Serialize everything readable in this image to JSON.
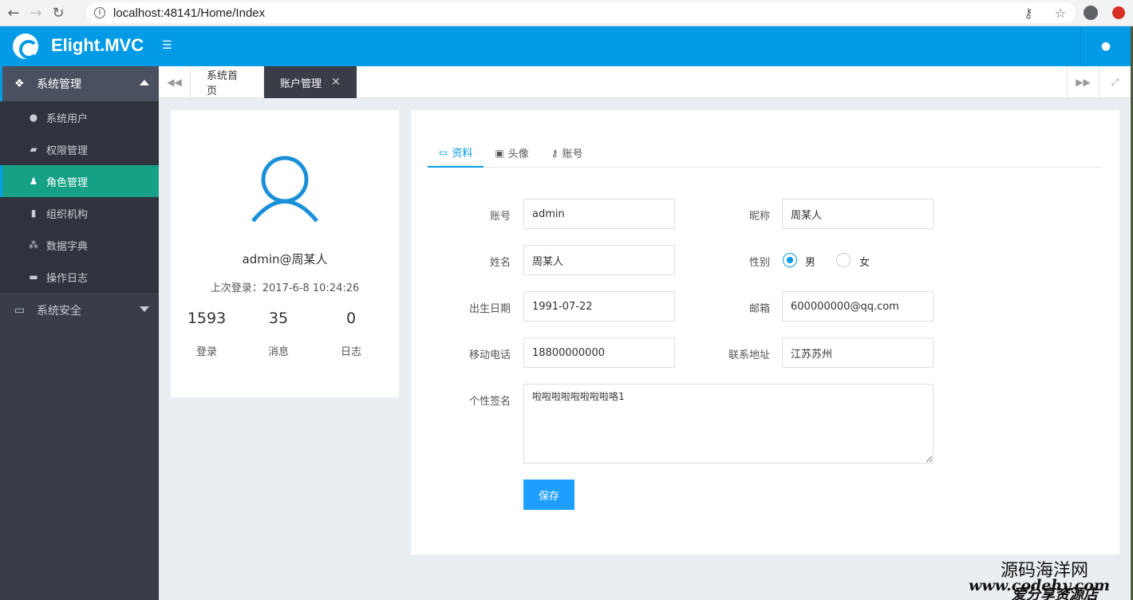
{
  "browser": {
    "url": "localhost:48141/Home/Index"
  },
  "header": {
    "app_title": "Elight.MVC"
  },
  "sidebar": {
    "groups": [
      {
        "label": "系统管理",
        "expanded": true,
        "items": [
          {
            "label": "系统用户",
            "icon": "user-circle-icon"
          },
          {
            "label": "权限管理",
            "icon": "briefcase-icon"
          },
          {
            "label": "角色管理",
            "icon": "users-icon",
            "active": true
          },
          {
            "label": "组织机构",
            "icon": "building-icon"
          },
          {
            "label": "数据字典",
            "icon": "sitemap-icon"
          },
          {
            "label": "操作日志",
            "icon": "folder-open-icon"
          }
        ]
      },
      {
        "label": "系统安全",
        "expanded": false
      }
    ]
  },
  "tabs": {
    "items": [
      {
        "label": "系统首页"
      },
      {
        "label": "账户管理",
        "active": true
      }
    ]
  },
  "profile": {
    "name": "admin@周某人",
    "last_login_label": "上次登录：",
    "last_login_value": "2017-6-8 10:24:26",
    "stats": [
      {
        "value": "1593",
        "label": "登录"
      },
      {
        "value": "35",
        "label": "消息"
      },
      {
        "value": "0",
        "label": "日志"
      }
    ]
  },
  "form": {
    "tabs": [
      {
        "label": "资料",
        "icon": "id-card-icon",
        "active": true
      },
      {
        "label": "头像",
        "icon": "image-icon"
      },
      {
        "label": "账号",
        "icon": "key-icon"
      }
    ],
    "fields": {
      "account": {
        "label": "账号",
        "value": "admin"
      },
      "nickname": {
        "label": "昵称",
        "value": "周某人"
      },
      "name": {
        "label": "姓名",
        "value": "周某人"
      },
      "gender": {
        "label": "性别",
        "options": [
          "男",
          "女"
        ],
        "selected": "男"
      },
      "birthday": {
        "label": "出生日期",
        "value": "1991-07-22"
      },
      "email": {
        "label": "邮箱",
        "value": "600000000@qq.com"
      },
      "mobile": {
        "label": "移动电话",
        "value": "18800000000"
      },
      "address": {
        "label": "联系地址",
        "value": "江苏苏州"
      },
      "signature": {
        "label": "个性签名",
        "value": "啦啦啦啦啦啦啦啦咯1"
      }
    },
    "save_label": "保存"
  },
  "colors": {
    "header": "#039be5",
    "sidebar": "#383d48",
    "active_item": "#16a085",
    "primary_button": "#1e9fff"
  },
  "watermark": {
    "line1": "源码海洋网",
    "line2": "www.codehy.com",
    "line3": "爱分享资源店"
  }
}
